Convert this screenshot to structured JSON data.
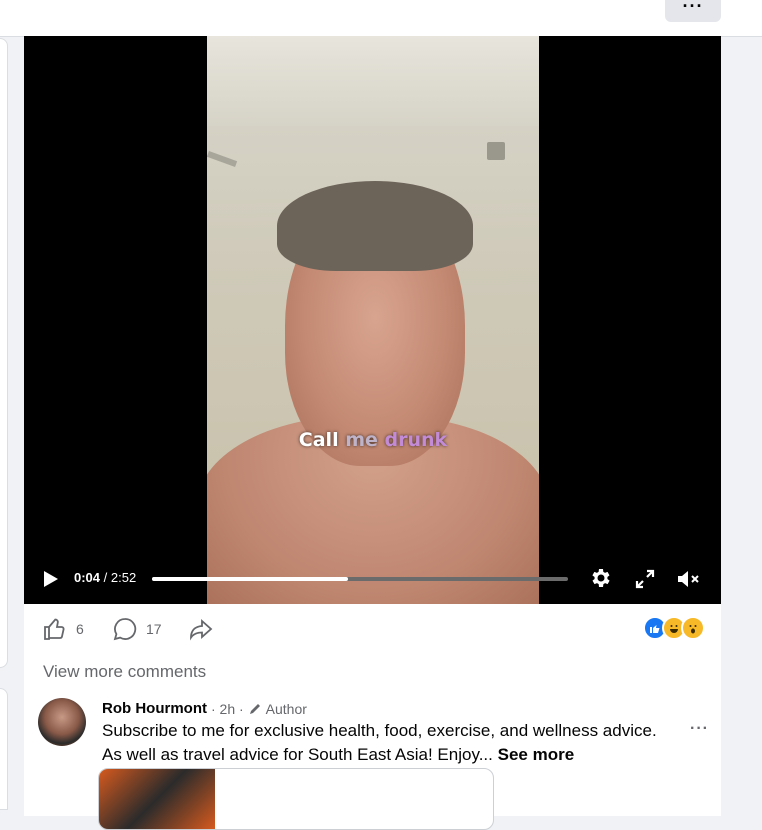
{
  "topbar": {
    "more_label": "···"
  },
  "video": {
    "caption": {
      "w1": "Call",
      "w2": "me",
      "w3": "drunk"
    },
    "current_time": "0:04",
    "separator": " / ",
    "duration": "2:52",
    "progress_fraction": 0.47
  },
  "actions": {
    "like_count": "6",
    "comment_count": "17"
  },
  "reactions": [
    "like-reaction",
    "haha-reaction",
    "wow-reaction"
  ],
  "comments": {
    "view_more": "View more comments",
    "items": [
      {
        "author": "Rob Hourmont",
        "time": "· 2h ·",
        "badge": "Author",
        "text_line1": "Subscribe to me for exclusive health, food, exercise, and wellness advice.",
        "text_line2": "As well as travel advice for South East Asia! Enjoy...",
        "see_more": "See more",
        "menu": "···"
      }
    ]
  },
  "colors": {
    "accent": "#1877f2",
    "muted": "#65676b"
  }
}
